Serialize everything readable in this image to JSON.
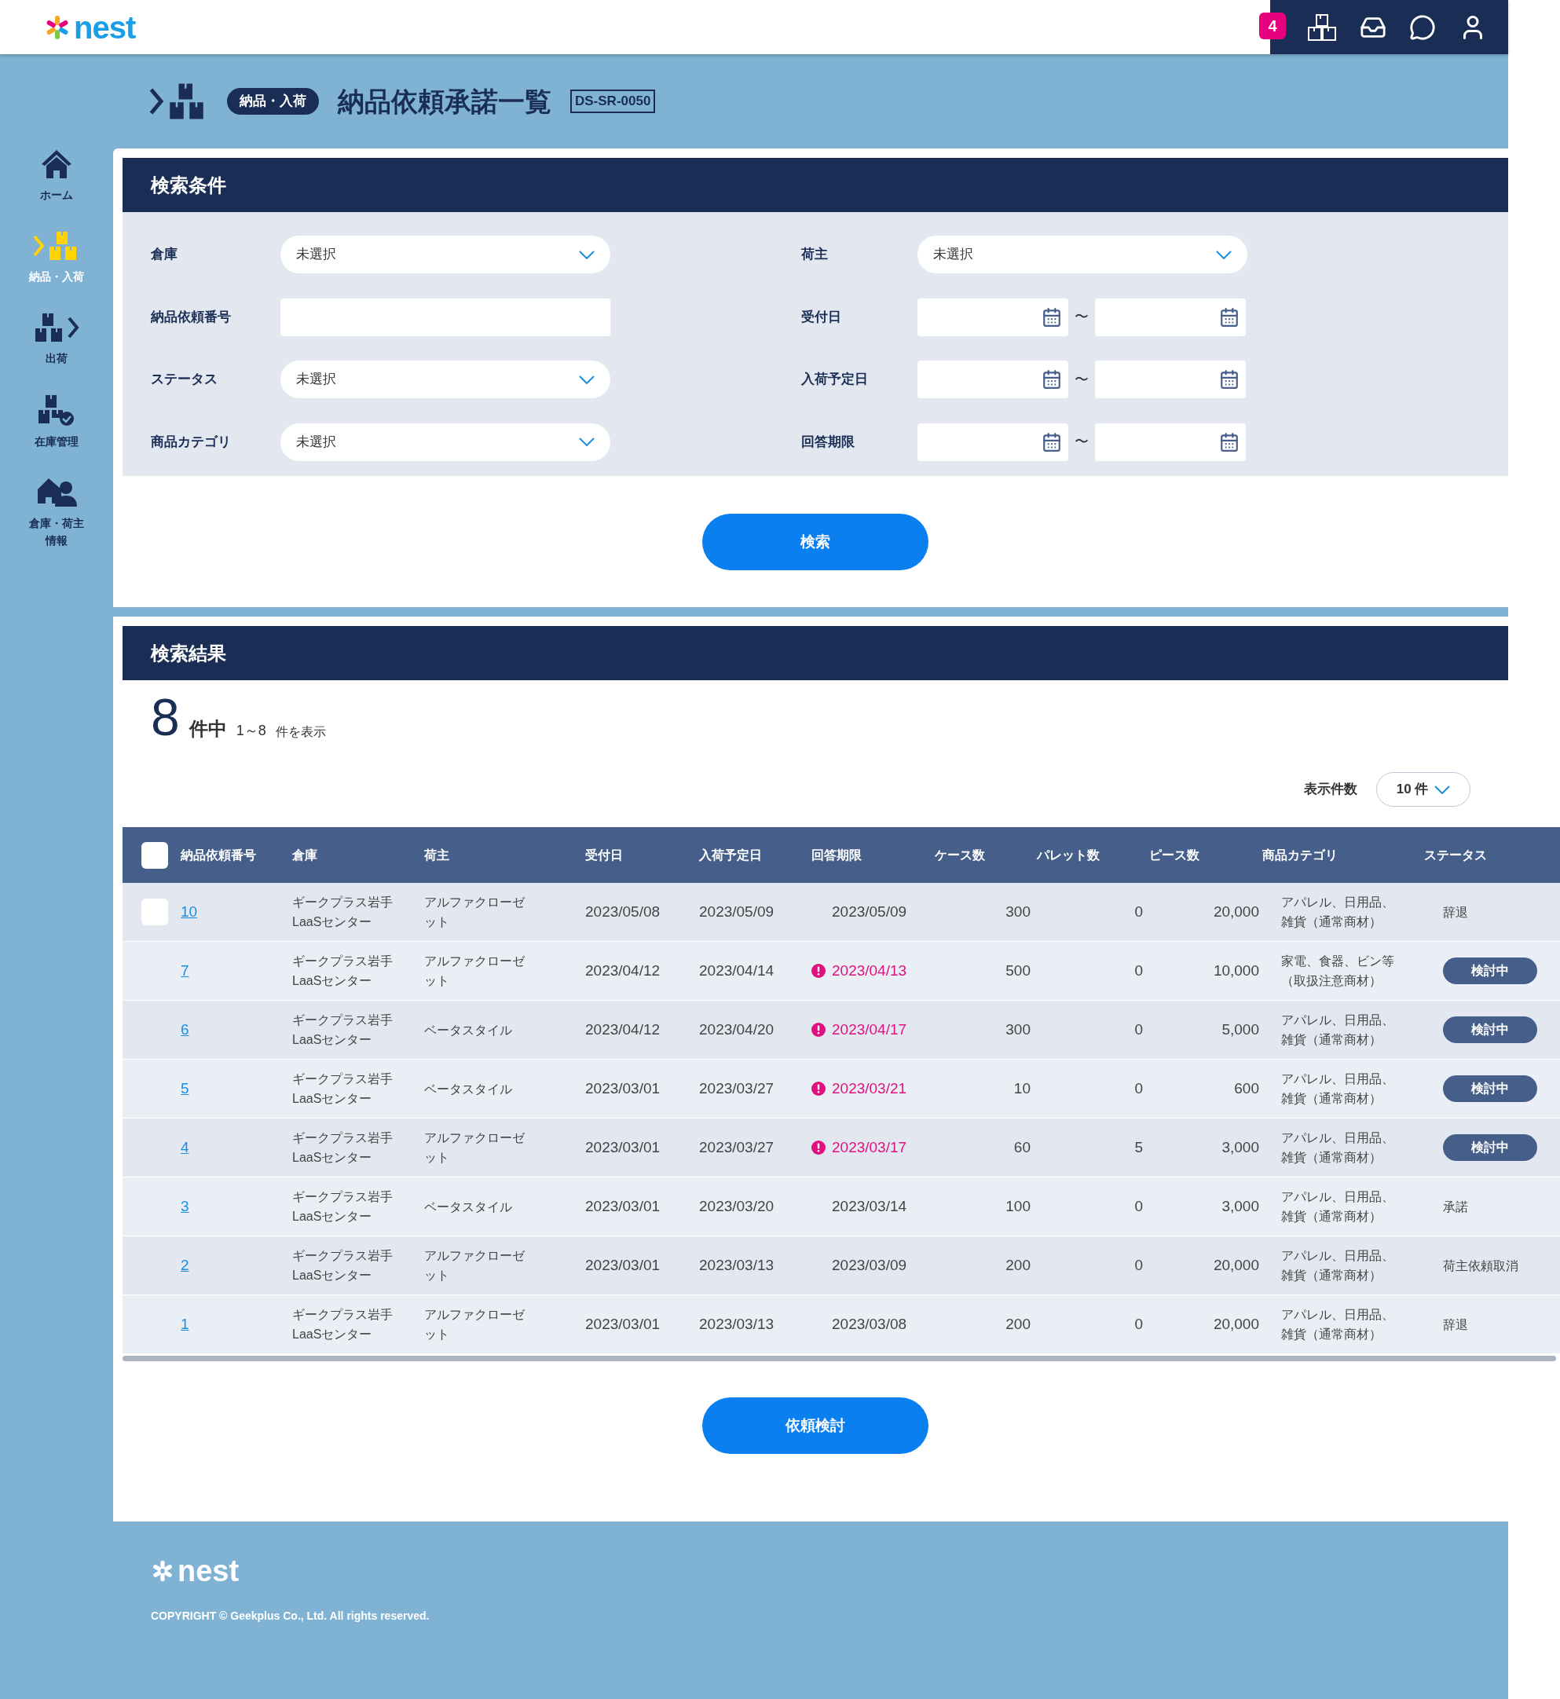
{
  "header": {
    "logo": "nest",
    "notification_count": "4"
  },
  "sidebar": {
    "items": [
      {
        "label": "ホーム",
        "selected": false
      },
      {
        "label": "納品・入荷",
        "selected": true
      },
      {
        "label": "出荷",
        "selected": false
      },
      {
        "label": "在庫管理",
        "selected": false
      },
      {
        "label": "倉庫・荷主情報",
        "selected": false
      }
    ]
  },
  "page_title": {
    "category": "納品・入荷",
    "title": "納品依頼承諾一覧",
    "screen_id": "DS-SR-0050"
  },
  "search": {
    "title": "検索条件",
    "fields": [
      {
        "label": "倉庫",
        "kind": "select",
        "value": "未選択"
      },
      {
        "label": "荷主",
        "kind": "select",
        "value": "未選択"
      },
      {
        "label": "納品依頼番号",
        "kind": "text"
      },
      {
        "label": "受付日",
        "kind": "date_range",
        "separator": "〜"
      },
      {
        "label": "ステータス",
        "kind": "select",
        "value": "未選択"
      },
      {
        "label": "入荷予定日",
        "kind": "date_range",
        "separator": "〜"
      },
      {
        "label": "商品カテゴリ",
        "kind": "select",
        "value": "未選択"
      },
      {
        "label": "回答期限",
        "kind": "date_range",
        "separator": "〜"
      }
    ],
    "button": "検索"
  },
  "results": {
    "title": "検索結果",
    "total": "8",
    "total_unit": "件中",
    "range": "1～8",
    "range_suffix": "件を表示",
    "page_size_label": "表示件数",
    "page_size": "10 件",
    "header_checkbox": {
      "checked": false
    },
    "columns": [
      "納品依頼番号",
      "倉庫",
      "荷主",
      "受付日",
      "入荷予定日",
      "回答期限",
      "ケース数",
      "パレット数",
      "ピース数",
      "商品カテゴリ",
      "ステータス"
    ],
    "rows": [
      {
        "selectable": true,
        "checked": false,
        "number": "10",
        "warehouse": "ギークプラス岩手LaaSセンター",
        "shipper": "アルファクローゼット",
        "received": "2023/05/08",
        "arrival": "2023/05/09",
        "deadline": "2023/05/09",
        "deadline_alert": false,
        "cases": "300",
        "pallets": "0",
        "pieces": "20,000",
        "category": "アパレル、日用品、雑貨（通常商材）",
        "status": "辞退",
        "kind": "text"
      },
      {
        "selectable": false,
        "number": "7",
        "warehouse": "ギークプラス岩手LaaSセンター",
        "shipper": "アルファクローゼット",
        "received": "2023/04/12",
        "arrival": "2023/04/14",
        "deadline": "2023/04/13",
        "deadline_alert": true,
        "cases": "500",
        "pallets": "0",
        "pieces": "10,000",
        "category": "家電、食器、ビン等（取扱注意商材）",
        "status": "検討中",
        "kind": "badge"
      },
      {
        "selectable": false,
        "number": "6",
        "warehouse": "ギークプラス岩手LaaSセンター",
        "shipper": "ベータスタイル",
        "received": "2023/04/12",
        "arrival": "2023/04/20",
        "deadline": "2023/04/17",
        "deadline_alert": true,
        "cases": "300",
        "pallets": "0",
        "pieces": "5,000",
        "category": "アパレル、日用品、雑貨（通常商材）",
        "status": "検討中",
        "kind": "badge"
      },
      {
        "selectable": false,
        "number": "5",
        "warehouse": "ギークプラス岩手LaaSセンター",
        "shipper": "ベータスタイル",
        "received": "2023/03/01",
        "arrival": "2023/03/27",
        "deadline": "2023/03/21",
        "deadline_alert": true,
        "cases": "10",
        "pallets": "0",
        "pieces": "600",
        "category": "アパレル、日用品、雑貨（通常商材）",
        "status": "検討中",
        "kind": "badge"
      },
      {
        "selectable": false,
        "number": "4",
        "warehouse": "ギークプラス岩手LaaSセンター",
        "shipper": "アルファクローゼット",
        "received": "2023/03/01",
        "arrival": "2023/03/27",
        "deadline": "2023/03/17",
        "deadline_alert": true,
        "cases": "60",
        "pallets": "5",
        "pieces": "3,000",
        "category": "アパレル、日用品、雑貨（通常商材）",
        "status": "検討中",
        "kind": "badge"
      },
      {
        "selectable": false,
        "number": "3",
        "warehouse": "ギークプラス岩手LaaSセンター",
        "shipper": "ベータスタイル",
        "received": "2023/03/01",
        "arrival": "2023/03/20",
        "deadline": "2023/03/14",
        "deadline_alert": false,
        "cases": "100",
        "pallets": "0",
        "pieces": "3,000",
        "category": "アパレル、日用品、雑貨（通常商材）",
        "status": "承諾",
        "kind": "text"
      },
      {
        "selectable": false,
        "number": "2",
        "warehouse": "ギークプラス岩手LaaSセンター",
        "shipper": "アルファクローゼット",
        "received": "2023/03/01",
        "arrival": "2023/03/13",
        "deadline": "2023/03/09",
        "deadline_alert": false,
        "cases": "200",
        "pallets": "0",
        "pieces": "20,000",
        "category": "アパレル、日用品、雑貨（通常商材）",
        "status": "荷主依頼取消",
        "kind": "text"
      },
      {
        "selectable": false,
        "number": "1",
        "warehouse": "ギークプラス岩手LaaSセンター",
        "shipper": "アルファクローゼット",
        "received": "2023/03/01",
        "arrival": "2023/03/13",
        "deadline": "2023/03/08",
        "deadline_alert": false,
        "cases": "200",
        "pallets": "0",
        "pieces": "20,000",
        "category": "アパレル、日用品、雑貨（通常商材）",
        "status": "辞退",
        "kind": "text"
      }
    ],
    "button": "依頼検討"
  },
  "footer": {
    "logo": "nest",
    "copyright": "COPYRIGHT © Geekplus Co., Ltd. All rights reserved."
  }
}
